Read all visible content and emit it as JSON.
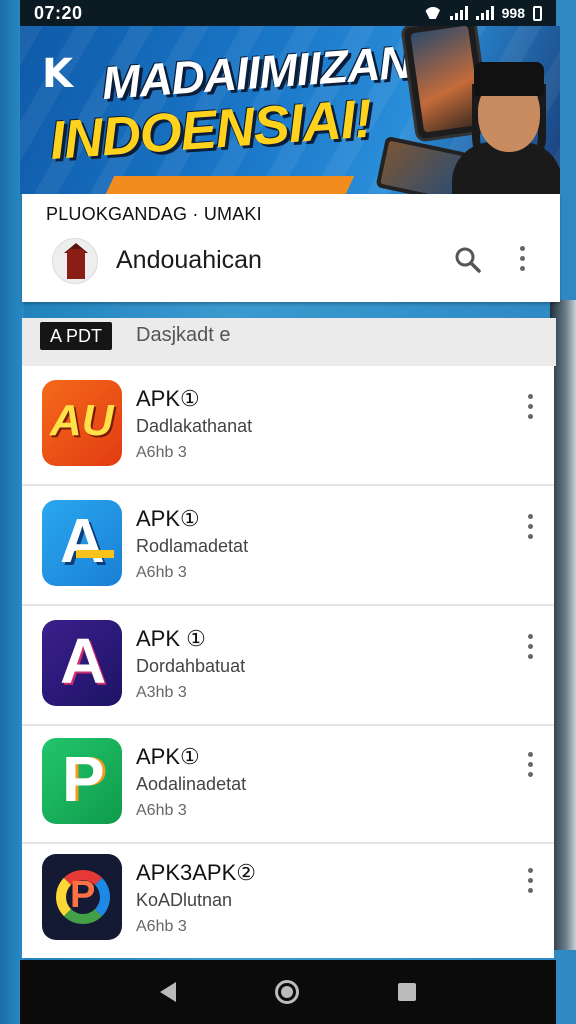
{
  "status_bar": {
    "time": "07:20",
    "right_text": "998"
  },
  "banner": {
    "logo_text": "K",
    "title_line1": "MADAIIMIIZAN",
    "title_line2": "INDOENSIAI!"
  },
  "store_header": {
    "breadcrumb": "PLUOKGANDAG · UMAKI",
    "store_name": "Andouahican",
    "search_icon": "search-icon",
    "menu_icon": "more-vert-icon"
  },
  "section": {
    "tag": "A PDT",
    "title": "Dasjkadt e"
  },
  "apps": [
    {
      "name": "APK①",
      "developer": "Dadlakathanat",
      "size": "A6hb 3",
      "icon": "orange-au-logo",
      "icon_text": "AU"
    },
    {
      "name": "APK①",
      "developer": "Rodlamadetat",
      "size": "A6hb 3",
      "icon": "blue-a-logo",
      "icon_text": "A"
    },
    {
      "name": "APK ①",
      "developer": "Dordahbatuat",
      "size": "A3hb 3",
      "icon": "purple-a-logo",
      "icon_text": "A"
    },
    {
      "name": "APK①",
      "developer": "Aodalinadetat",
      "size": "A6hb 3",
      "icon": "green-p-logo",
      "icon_text": "P"
    },
    {
      "name": "APK3APK②",
      "developer": "KoADlutnan",
      "size": "A6hb 3",
      "icon": "color-p-logo",
      "icon_text": "P"
    }
  ],
  "nav": {
    "back": "back-icon",
    "home": "home-icon",
    "recent": "recent-apps-icon"
  }
}
